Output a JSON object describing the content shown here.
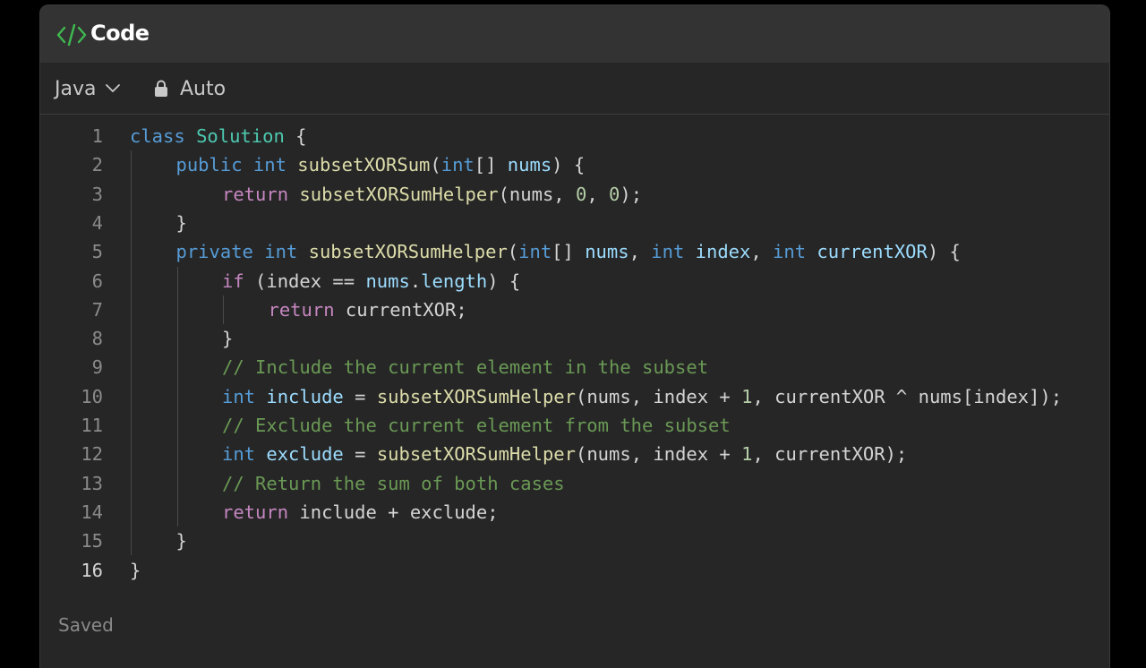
{
  "header": {
    "title": "Code",
    "icon": "code-icon"
  },
  "toolbar": {
    "language": "Java",
    "mode_label": "Auto"
  },
  "footer": {
    "status": "Saved"
  },
  "colors": {
    "keyword": "#569cd6",
    "control": "#c586c0",
    "type": "#4ec9b0",
    "function": "#dcdcaa",
    "variable": "#9cdcfe",
    "number": "#b5cea8",
    "comment": "#6a9955",
    "accent": "#3fb950"
  },
  "code": {
    "active_line": 16,
    "lines": [
      {
        "n": "1",
        "indent": 0,
        "tokens": [
          [
            "kw",
            "class"
          ],
          [
            "p",
            " "
          ],
          [
            "ty",
            "Solution"
          ],
          [
            "p",
            " {"
          ]
        ]
      },
      {
        "n": "2",
        "indent": 1,
        "tokens": [
          [
            "kw",
            "public"
          ],
          [
            "p",
            " "
          ],
          [
            "kw",
            "int"
          ],
          [
            "p",
            " "
          ],
          [
            "fn",
            "subsetXORSum"
          ],
          [
            "p",
            "("
          ],
          [
            "kw",
            "int"
          ],
          [
            "p",
            "[] "
          ],
          [
            "vr",
            "nums"
          ],
          [
            "p",
            ") {"
          ]
        ]
      },
      {
        "n": "3",
        "indent": 2,
        "tokens": [
          [
            "kw2",
            "return"
          ],
          [
            "p",
            " "
          ],
          [
            "fn",
            "subsetXORSumHelper"
          ],
          [
            "p",
            "(nums, "
          ],
          [
            "nm",
            "0"
          ],
          [
            "p",
            ", "
          ],
          [
            "nm",
            "0"
          ],
          [
            "p",
            ");"
          ]
        ]
      },
      {
        "n": "4",
        "indent": 1,
        "tokens": [
          [
            "p",
            "}"
          ]
        ]
      },
      {
        "n": "5",
        "indent": 1,
        "tokens": [
          [
            "kw",
            "private"
          ],
          [
            "p",
            " "
          ],
          [
            "kw",
            "int"
          ],
          [
            "p",
            " "
          ],
          [
            "fn",
            "subsetXORSumHelper"
          ],
          [
            "p",
            "("
          ],
          [
            "kw",
            "int"
          ],
          [
            "p",
            "[] "
          ],
          [
            "vr",
            "nums"
          ],
          [
            "p",
            ", "
          ],
          [
            "kw",
            "int"
          ],
          [
            "p",
            " "
          ],
          [
            "vr",
            "index"
          ],
          [
            "p",
            ", "
          ],
          [
            "kw",
            "int"
          ],
          [
            "p",
            " "
          ],
          [
            "vr",
            "currentXOR"
          ],
          [
            "p",
            ") {"
          ]
        ]
      },
      {
        "n": "6",
        "indent": 2,
        "tokens": [
          [
            "kw2",
            "if"
          ],
          [
            "p",
            " (index == "
          ],
          [
            "vr",
            "nums"
          ],
          [
            "p",
            "."
          ],
          [
            "vr",
            "length"
          ],
          [
            "p",
            ") {"
          ]
        ]
      },
      {
        "n": "7",
        "indent": 3,
        "tokens": [
          [
            "kw2",
            "return"
          ],
          [
            "p",
            " currentXOR;"
          ]
        ]
      },
      {
        "n": "8",
        "indent": 2,
        "tokens": [
          [
            "p",
            "}"
          ]
        ]
      },
      {
        "n": "9",
        "indent": 2,
        "tokens": [
          [
            "cm",
            "// Include the current element in the subset"
          ]
        ]
      },
      {
        "n": "10",
        "indent": 2,
        "tokens": [
          [
            "kw",
            "int"
          ],
          [
            "p",
            " "
          ],
          [
            "vr",
            "include"
          ],
          [
            "p",
            " = "
          ],
          [
            "fn",
            "subsetXORSumHelper"
          ],
          [
            "p",
            "(nums, index + "
          ],
          [
            "nm",
            "1"
          ],
          [
            "p",
            ", currentXOR ^ nums[index]);"
          ]
        ]
      },
      {
        "n": "11",
        "indent": 2,
        "tokens": [
          [
            "cm",
            "// Exclude the current element from the subset"
          ]
        ]
      },
      {
        "n": "12",
        "indent": 2,
        "tokens": [
          [
            "kw",
            "int"
          ],
          [
            "p",
            " "
          ],
          [
            "vr",
            "exclude"
          ],
          [
            "p",
            " = "
          ],
          [
            "fn",
            "subsetXORSumHelper"
          ],
          [
            "p",
            "(nums, index + "
          ],
          [
            "nm",
            "1"
          ],
          [
            "p",
            ", currentXOR);"
          ]
        ]
      },
      {
        "n": "13",
        "indent": 2,
        "tokens": [
          [
            "cm",
            "// Return the sum of both cases"
          ]
        ]
      },
      {
        "n": "14",
        "indent": 2,
        "tokens": [
          [
            "kw2",
            "return"
          ],
          [
            "p",
            " include + exclude;"
          ]
        ]
      },
      {
        "n": "15",
        "indent": 1,
        "tokens": [
          [
            "p",
            "}"
          ]
        ]
      },
      {
        "n": "16",
        "indent": 0,
        "tokens": [
          [
            "p",
            "}"
          ]
        ]
      }
    ]
  }
}
